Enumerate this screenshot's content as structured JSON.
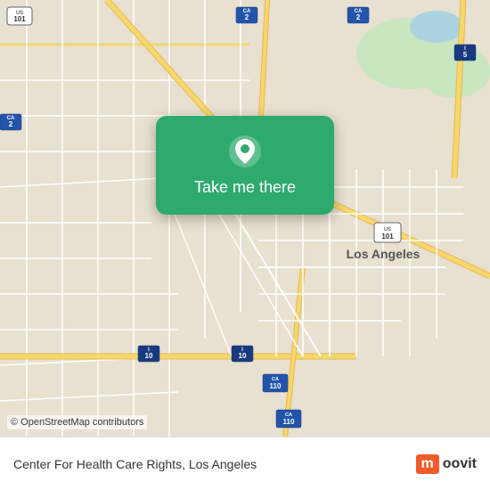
{
  "map": {
    "attribution": "© OpenStreetMap contributors",
    "backgroundColor": "#e8e0d0"
  },
  "card": {
    "button_label": "Take me there",
    "pin_icon": "location-pin"
  },
  "bottom_bar": {
    "location_text": "Center For Health Care Rights, Los Angeles",
    "logo_m": "m",
    "logo_text": "oovit"
  }
}
